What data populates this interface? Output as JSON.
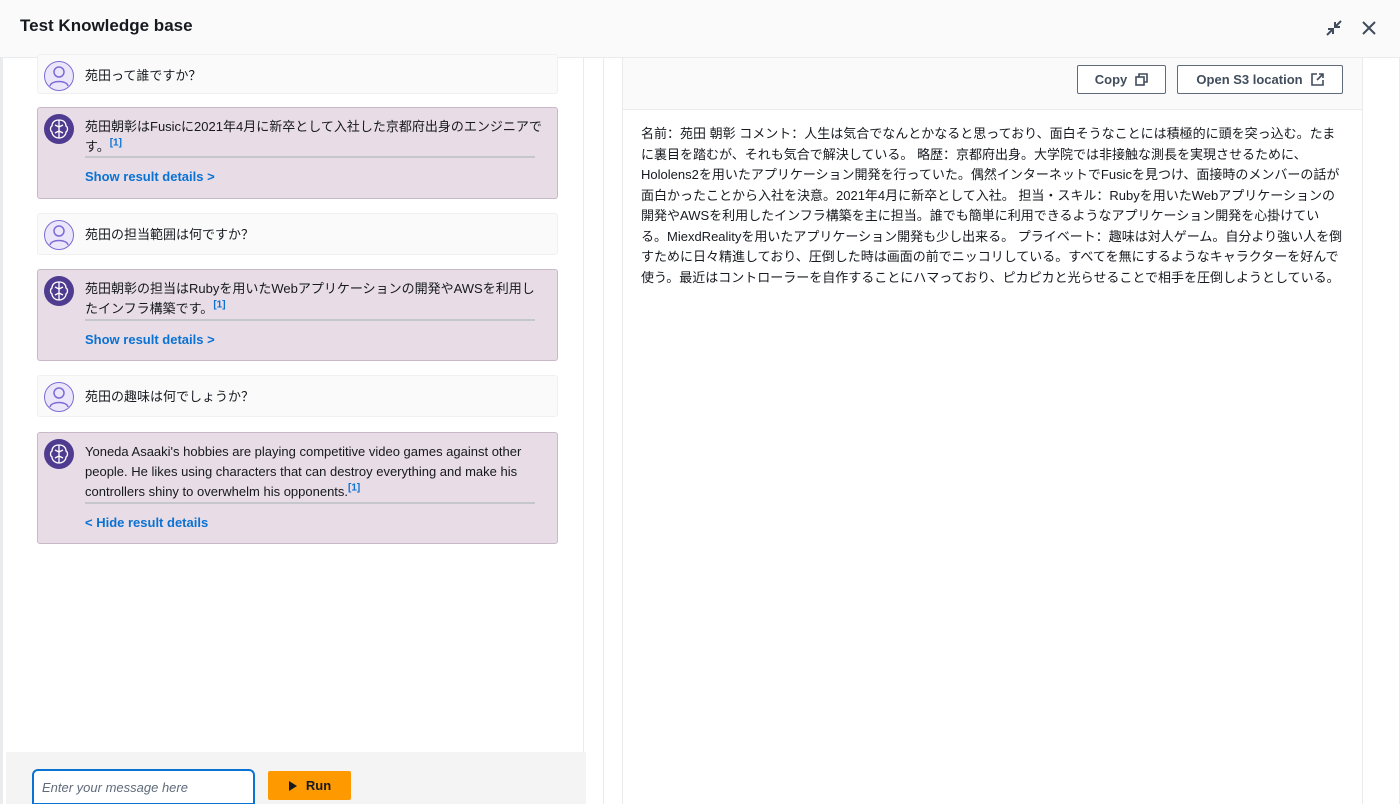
{
  "header": {
    "title": "Test Knowledge base"
  },
  "chat": {
    "messages": [
      {
        "role": "user",
        "text": "苑田って誰ですか？"
      },
      {
        "role": "bot",
        "text": "苑田朝彰はFusicに2021年4月に新卒として入社した京都府出身のエンジニアです。",
        "citation": "[1]",
        "details_link": "Show result details >"
      },
      {
        "role": "user",
        "text": "苑田の担当範囲は何ですか？"
      },
      {
        "role": "bot",
        "text": "苑田朝彰の担当はRubyを用いたWebアプリケーションの開発やAWSを利用したインフラ構築です。",
        "citation": "[1]",
        "details_link": "Show result details >"
      },
      {
        "role": "user",
        "text": "苑田の趣味は何でしょうか？"
      },
      {
        "role": "bot",
        "text": "Yoneda Asaaki's hobbies are playing competitive video games against other people. He likes using characters that can destroy everything and make his controllers shiny to overwhelm his opponents.",
        "citation": "[1]",
        "details_link": "< Hide result details"
      }
    ]
  },
  "input": {
    "placeholder": "Enter your message here",
    "run_label": "Run"
  },
  "source": {
    "copy_label": "Copy",
    "open_s3_label": "Open S3 location",
    "content": "名前：苑田 朝彰 コメント：人生は気合でなんとかなると思っており、面白そうなことには積極的に頭を突っ込む。たまに裏目を踏むが、それも気合で解決している。 略歴：京都府出身。大学院では非接触な測長を実現させるために、Hololens2を用いたアプリケーション開発を行っていた。偶然インターネットでFusicを見つけ、面接時のメンバーの話が面白かったことから入社を決意。2021年4月に新卒として入社。 担当・スキル：Rubyを用いたWebアプリケーションの開発やAWSを利用したインフラ構築を主に担当。誰でも簡単に利用できるようなアプリケーション開発を心掛けている。MiexdRealityを用いたアプリケーション開発も少し出来る。 プライベート：趣味は対人ゲーム。自分より強い人を倒すために日々精進しており、圧倒した時は画面の前でニッコリしている。すべてを無にするようなキャラクターを好んで使う。最近はコントローラーを自作することにハマっており、ピカピカと光らせることで相手を圧倒しようとしている。"
  },
  "icons": {
    "minimize": "minimize-icon",
    "close": "close-icon",
    "user_avatar": "user-avatar-icon",
    "bot_avatar": "ai-brain-icon",
    "copy": "copy-icon",
    "external": "external-link-icon",
    "play": "play-icon"
  },
  "colors": {
    "accent": "#0972d3",
    "run_button": "#ff9900",
    "bot_bubble": "#e8dce6",
    "bot_avatar": "#4f3c91"
  }
}
